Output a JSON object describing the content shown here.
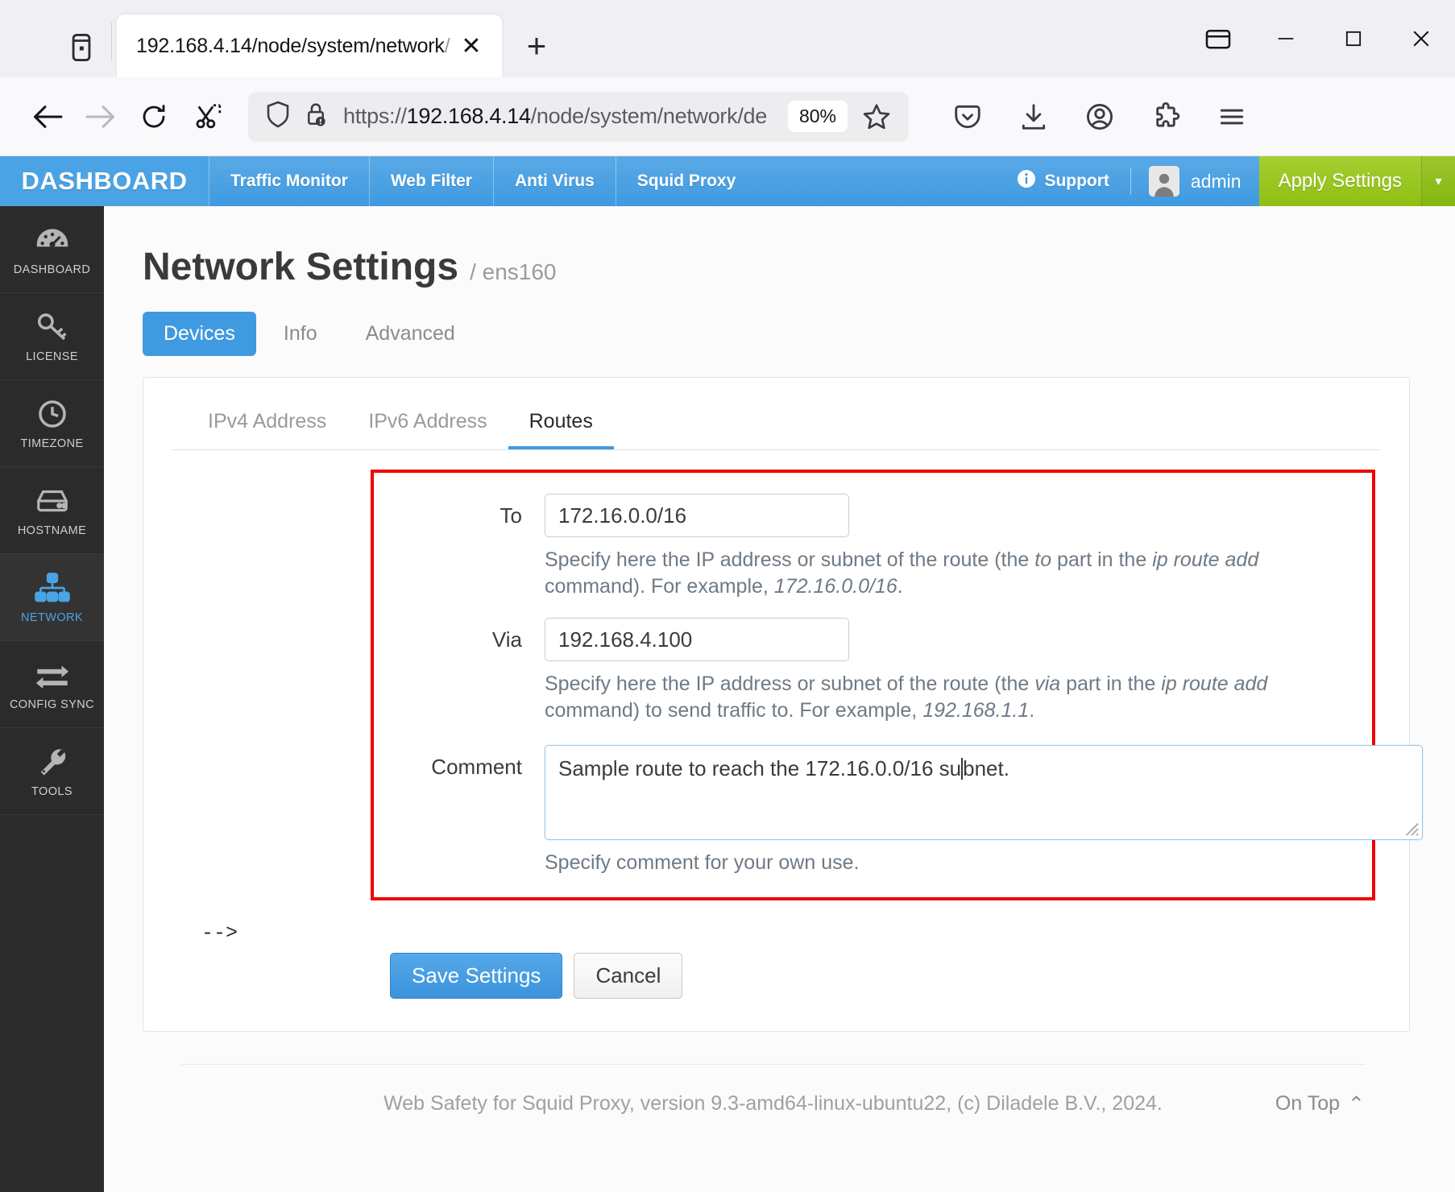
{
  "browser": {
    "tab": {
      "title_main": "192.168.4.14/node/system/network",
      "title_dim": "/",
      "close_glyph": "✕"
    },
    "newtab_label": "+",
    "window_controls": {
      "restore_down": "window-icon",
      "minimize": "–",
      "maximize": "□",
      "close": "✕"
    },
    "url": {
      "scheme": "https://",
      "host": "192.168.4.14",
      "path": "/node/system/network/de",
      "zoom_level": "80%"
    }
  },
  "topbar": {
    "brand": "DASHBOARD",
    "nav_items": [
      {
        "label": "Traffic Monitor"
      },
      {
        "label": "Web Filter"
      },
      {
        "label": "Anti Virus"
      },
      {
        "label": "Squid Proxy"
      }
    ],
    "support_label": "Support",
    "user_name": "admin",
    "apply_label": "Apply Settings",
    "apply_caret": "▾",
    "accent_color": "#3f9ae0",
    "apply_color": "#8fbf14"
  },
  "sidebar": {
    "items": [
      {
        "label": "DASHBOARD",
        "icon": "gauge-icon",
        "active": false
      },
      {
        "label": "LICENSE",
        "icon": "key-icon",
        "active": false
      },
      {
        "label": "TIMEZONE",
        "icon": "clock-icon",
        "active": false
      },
      {
        "label": "HOSTNAME",
        "icon": "server-icon",
        "active": false
      },
      {
        "label": "NETWORK",
        "icon": "network-icon",
        "active": true
      },
      {
        "label": "CONFIG SYNC",
        "icon": "sync-arrows-icon",
        "active": false
      },
      {
        "label": "TOOLS",
        "icon": "wrench-icon",
        "active": false
      }
    ]
  },
  "page": {
    "title": "Network Settings",
    "subtitle": "/ ens160",
    "tabs": [
      {
        "label": "Devices",
        "active": true
      },
      {
        "label": "Info",
        "active": false
      },
      {
        "label": "Advanced",
        "active": false
      }
    ],
    "subtabs": [
      {
        "label": "IPv4 Address",
        "active": false
      },
      {
        "label": "IPv6 Address",
        "active": false
      },
      {
        "label": "Routes",
        "active": true
      }
    ]
  },
  "form": {
    "to": {
      "label": "To",
      "value": "172.16.0.0/16",
      "help_1": "Specify here the IP address or subnet of the route (the ",
      "help_em_1": "to",
      "help_2": " part in the ",
      "help_em_2": "ip route add",
      "help_3": " command). For example, ",
      "help_em_3": "172.16.0.0/16",
      "help_4": "."
    },
    "via": {
      "label": "Via",
      "value": "192.168.4.100",
      "help_1": "Specify here the IP address or subnet of the route (the ",
      "help_em_1": "via",
      "help_2": " part in the ",
      "help_em_2": "ip route add",
      "help_3": " command) to send traffic to. For example, ",
      "help_em_3": "192.168.1.1",
      "help_4": "."
    },
    "comment": {
      "label": "Comment",
      "value_before_caret": "Sample route to reach the 172.16.0.0/16 su",
      "value_after_caret": "bnet.",
      "help": "Specify comment for your own use."
    },
    "html_comment_marker": "-->",
    "save_label": "Save Settings",
    "cancel_label": "Cancel",
    "highlight_color": "#f00000"
  },
  "footer": {
    "text": "Web Safety for Squid Proxy, version 9.3-amd64-linux-ubuntu22, (c) Diladele B.V., 2024.",
    "ontop_label": "On Top",
    "ontop_caret": "⌃"
  }
}
